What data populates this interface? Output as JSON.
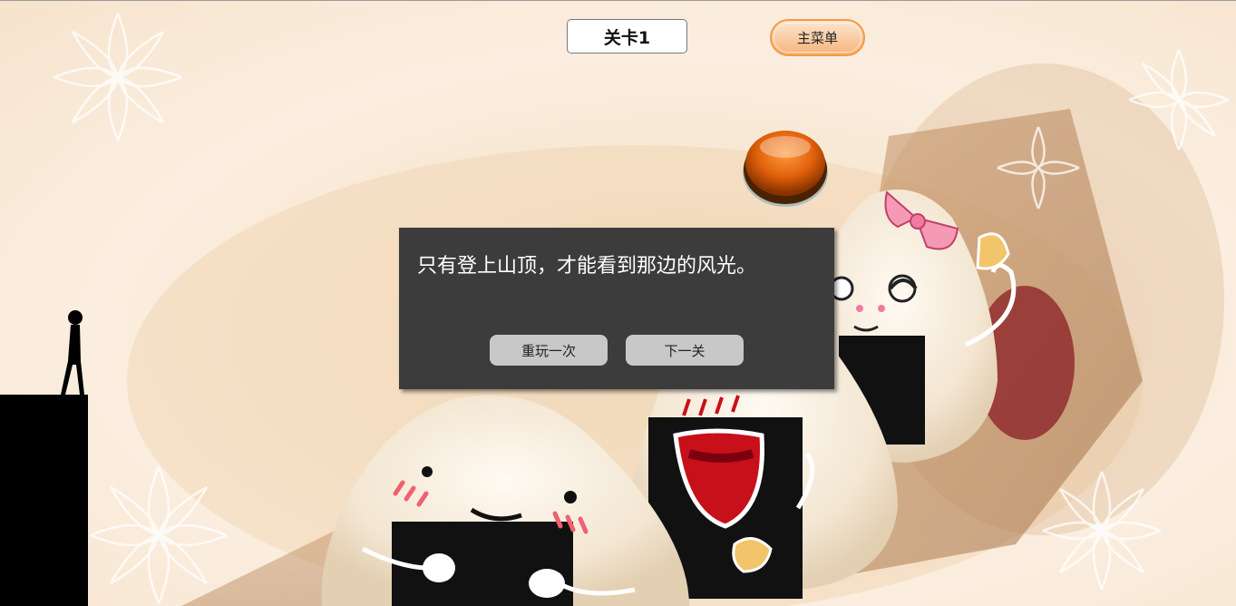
{
  "header": {
    "level_label": "关卡1",
    "main_menu_label": "主菜单"
  },
  "dialog": {
    "message": "只有登上山顶，才能看到那边的风光。",
    "replay_label": "重玩一次",
    "next_label": "下一关"
  },
  "colors": {
    "dialog_bg": "#3c3c3c",
    "dialog_button": "#c8c8c8",
    "menu_border": "#f39a45",
    "big_button": "#e0600a"
  },
  "icons": {
    "big_button": "orange-round-button-icon",
    "player": "stickman-icon"
  }
}
